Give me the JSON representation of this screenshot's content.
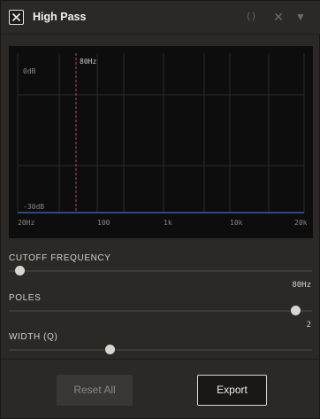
{
  "header": {
    "title": "High Pass",
    "toggle_icon": "close-x-icon",
    "code_icon": "⟨⟩",
    "close_icon": "✕",
    "menu_icon": "▼"
  },
  "graph": {
    "marker_label": "80Hz",
    "top_db_label": "0dB",
    "bottom_db_label": "-30dB",
    "x_ticks": [
      "20Hz",
      "100",
      "1k",
      "10k",
      "20k"
    ],
    "response_color": "#3f6bd6",
    "marker_color": "#c0445a"
  },
  "controls": {
    "cutoff": {
      "label": "CUTOFF FREQUENCY",
      "value": "80Hz",
      "position": 0.0
    },
    "poles": {
      "label": "POLES",
      "value": "2",
      "position": 1.0
    },
    "width": {
      "label": "WIDTH (Q)",
      "value": "",
      "position": 0.33
    }
  },
  "footer": {
    "reset_label": "Reset All",
    "export_label": "Export"
  }
}
